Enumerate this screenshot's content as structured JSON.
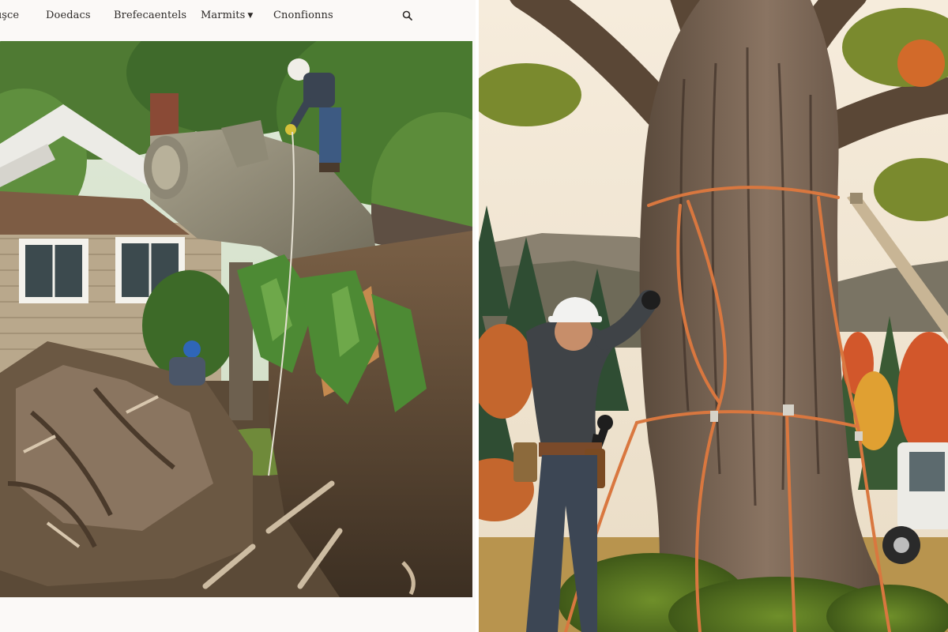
{
  "nav": {
    "items": [
      {
        "label": "ışce"
      },
      {
        "label": "Doedacs"
      },
      {
        "label": "Brefecaentels"
      },
      {
        "label": "Marmits",
        "has_dropdown": true
      },
      {
        "label": "Cnonfionns"
      }
    ],
    "search_icon": "search-icon"
  },
  "colors": {
    "page_background": "#fbf9f7",
    "nav_text": "#2d2a28",
    "rope_orange": "#d9773f",
    "helmet_white": "#f2f2f0",
    "moss_green": "#5d7a22"
  },
  "photos": [
    {
      "subject": "Fallen uprooted tree on a house with workers"
    },
    {
      "subject": "Arborist in white helmet rigging orange ropes around a large tree trunk"
    }
  ]
}
